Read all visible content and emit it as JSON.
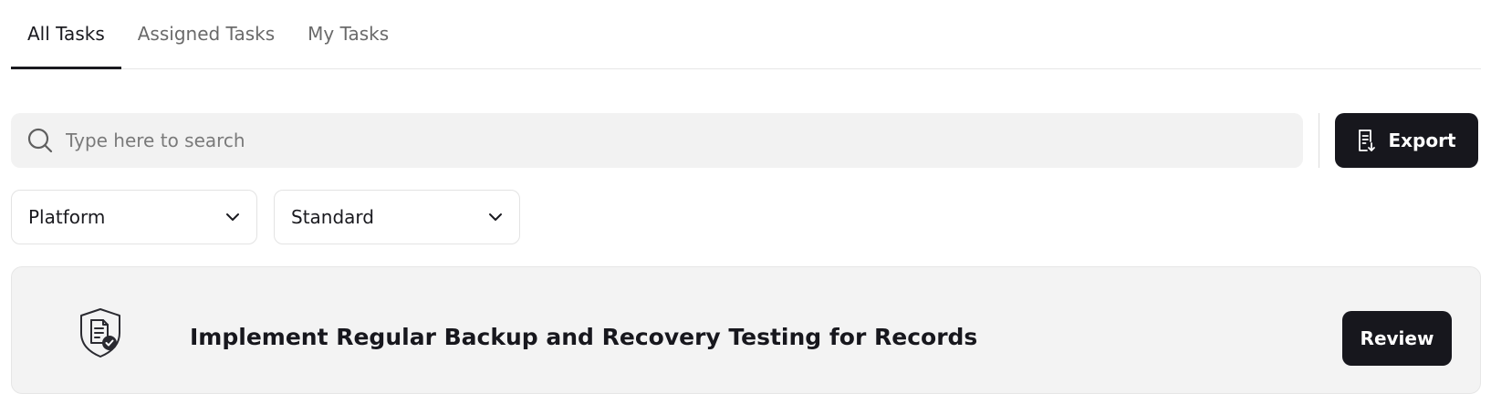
{
  "tabs": [
    {
      "label": "All Tasks",
      "active": true
    },
    {
      "label": "Assigned Tasks",
      "active": false
    },
    {
      "label": "My Tasks",
      "active": false
    }
  ],
  "search": {
    "placeholder": "Type here to search",
    "value": "",
    "icon": "search-icon"
  },
  "toolbar": {
    "export_label": "Export",
    "export_icon": "document-download-icon"
  },
  "filters": {
    "platform": {
      "selected": "Platform"
    },
    "standard": {
      "selected": "Standard"
    }
  },
  "task": {
    "title": "Implement Regular Backup and Recovery Testing for Records",
    "icon": "shield-document-check-icon",
    "action_label": "Review"
  },
  "colors": {
    "primary_button": "#17171d",
    "search_bg": "#f2f2f2",
    "card_bg": "#f3f3f3"
  }
}
